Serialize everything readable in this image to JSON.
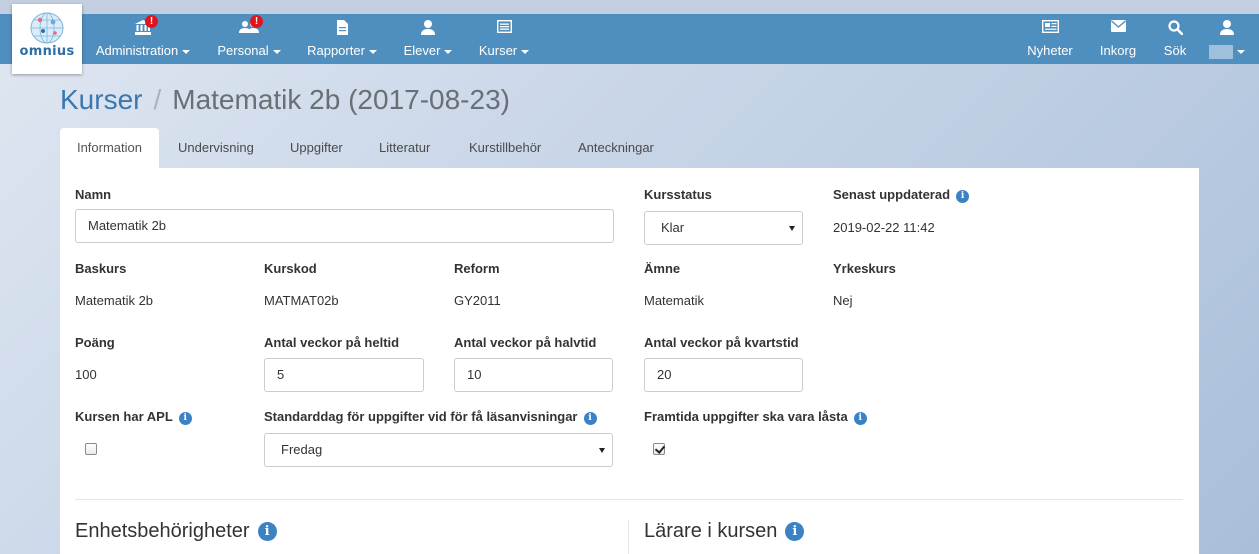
{
  "app": {
    "logo_text": "omnius"
  },
  "nav": {
    "left": [
      {
        "label": "Administration",
        "icon": "bank-icon",
        "badge": "!"
      },
      {
        "label": "Personal",
        "icon": "users-icon",
        "badge": "!"
      },
      {
        "label": "Rapporter",
        "icon": "file-icon"
      },
      {
        "label": "Elever",
        "icon": "user-icon"
      },
      {
        "label": "Kurser",
        "icon": "list-icon"
      }
    ],
    "right": [
      {
        "label": "Nyheter",
        "icon": "newspaper-icon"
      },
      {
        "label": "Inkorg",
        "icon": "envelope-icon"
      },
      {
        "label": "Sök",
        "icon": "search-icon"
      }
    ],
    "user": {
      "icon": "user-icon"
    }
  },
  "breadcrumb": {
    "parent": "Kurser",
    "separator": "/",
    "current": "Matematik 2b (2017-08-23)"
  },
  "tabs": [
    "Information",
    "Undervisning",
    "Uppgifter",
    "Litteratur",
    "Kurstillbehör",
    "Anteckningar"
  ],
  "form": {
    "namn_label": "Namn",
    "namn_value": "Matematik 2b",
    "kursstatus_label": "Kursstatus",
    "kursstatus_value": "Klar",
    "senast_label": "Senast uppdaterad",
    "senast_value": "2019-02-22 11:42",
    "baskurs_label": "Baskurs",
    "baskurs_value": "Matematik 2b",
    "kurskod_label": "Kurskod",
    "kurskod_value": "MATMAT02b",
    "reform_label": "Reform",
    "reform_value": "GY2011",
    "amne_label": "Ämne",
    "amne_value": "Matematik",
    "yrkeskurs_label": "Yrkeskurs",
    "yrkeskurs_value": "Nej",
    "poang_label": "Poäng",
    "poang_value": "100",
    "heltid_label": "Antal veckor på heltid",
    "heltid_value": "5",
    "halvtid_label": "Antal veckor på halvtid",
    "halvtid_value": "10",
    "kvartstid_label": "Antal veckor på kvartstid",
    "kvartstid_value": "20",
    "apl_label": "Kursen har APL",
    "apl_checked": false,
    "standarddag_label": "Standarddag för uppgifter vid för få läsanvisningar",
    "standarddag_value": "Fredag",
    "framtida_label": "Framtida uppgifter ska vara låsta",
    "framtida_checked": true,
    "info_glyph": "i"
  },
  "sections": {
    "enhets_title": "Enhetsbehörigheter",
    "larare_title": "Lärare i kursen"
  }
}
